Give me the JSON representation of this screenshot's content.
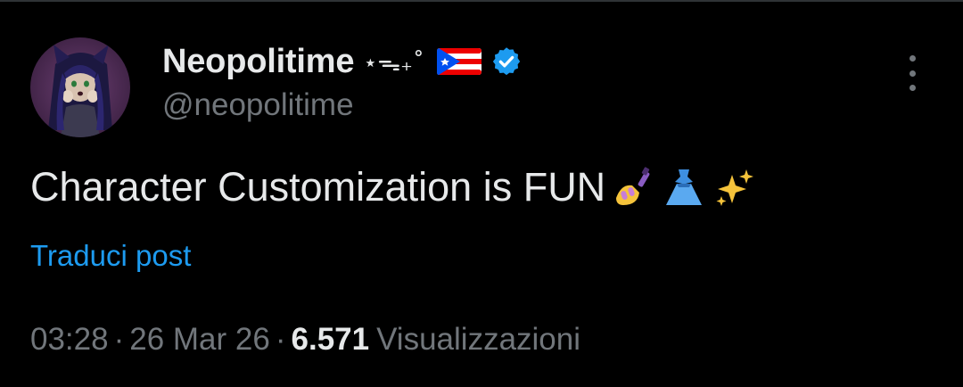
{
  "user": {
    "display_name": "Neopolitime",
    "decoration": "⋆ᯓ₊˚",
    "handle": "@neopolitime",
    "verified": true,
    "flag": "puerto-rico-flag"
  },
  "tweet": {
    "text": "Character Customization is FUN",
    "emojis": [
      "nail-polish-emoji",
      "dress-emoji",
      "sparkles-emoji"
    ],
    "translate_label": "Traduci post"
  },
  "meta": {
    "time": "03:28",
    "separator": "·",
    "date": "26 Mar 26",
    "views_count": "6.571",
    "views_label": "Visualizzazioni"
  },
  "colors": {
    "background": "#000000",
    "primary_text": "#e7e9ea",
    "secondary_text": "#71767b",
    "link": "#1d9bf0",
    "verified_badge": "#1d9bf0"
  },
  "icons": {
    "more": "more-vertical-icon",
    "verified": "verified-badge-icon"
  }
}
